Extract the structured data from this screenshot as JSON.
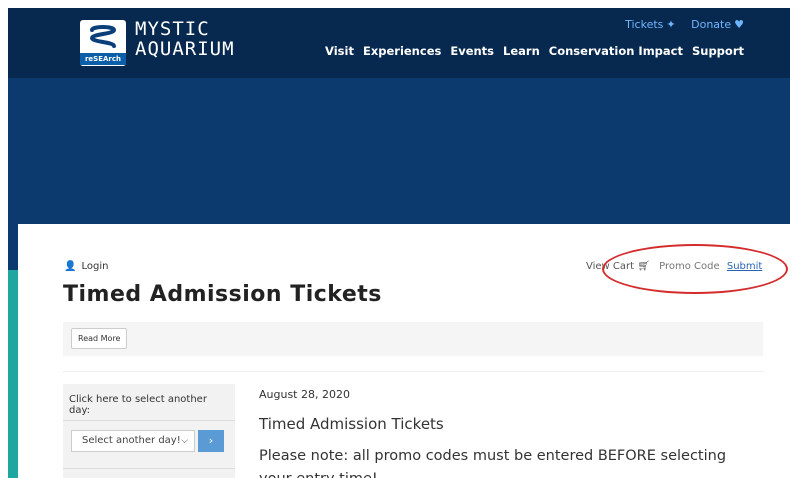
{
  "header": {
    "logo_research": "reSEArch",
    "logo_line1": "MYSTIC",
    "logo_line2": "AQUARIUM",
    "top_links": [
      {
        "label": "Tickets",
        "icon": "ticket-icon"
      },
      {
        "label": "Donate",
        "icon": "heart-icon"
      }
    ],
    "nav": [
      "Visit",
      "Experiences",
      "Events",
      "Learn",
      "Conservation Impact",
      "Support"
    ]
  },
  "colors": {
    "header_bg": "#07294f",
    "hero_bg": "#0d3a6e",
    "teal_accent": "#1fa6a0",
    "annotation_red": "#d42c2c",
    "link_blue": "#2a63b3"
  },
  "content": {
    "login_label": "Login",
    "view_cart_label": "View Cart",
    "promo_code_label": "Promo Code",
    "submit_label": "Submit",
    "page_title": "Timed Admission Tickets",
    "read_more_label": "Read More",
    "sidebar_label": "Click here to select another day:",
    "select_value": "Select another day!",
    "go_symbol": "›",
    "date": "August 28, 2020",
    "event_title": "Timed Admission Tickets",
    "note": "Please note: all promo codes must be entered BEFORE selecting your entry time!"
  }
}
